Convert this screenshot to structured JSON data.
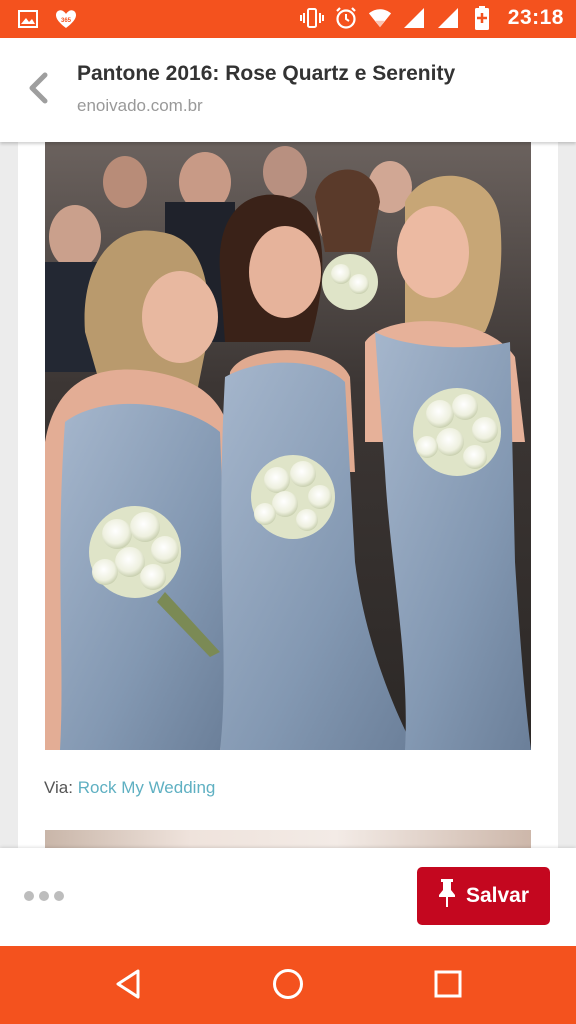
{
  "status_bar": {
    "color": "#f4521e",
    "left_icons": [
      "image-icon",
      "heart-365-icon"
    ],
    "heart_badge": "365",
    "right_icons": [
      "vibrate-icon",
      "alarm-icon",
      "wifi-icon",
      "signal-icon",
      "signal-icon",
      "battery-charging-icon"
    ],
    "time": "23:18"
  },
  "header": {
    "back_icon": "chevron-left-icon",
    "title": "Pantone 2016: Rose Quartz e Serenity",
    "domain": "enoivado.com.br"
  },
  "content": {
    "image_description": "Three bridesmaids in serenity blue dresses holding white rose bouquets",
    "caption_prefix": "Via:",
    "caption_link": "Rock My Wedding",
    "link_color": "#5fb0c2"
  },
  "action_bar": {
    "more_icon": "more-dots-icon",
    "save_icon": "pin-icon",
    "save_label": "Salvar",
    "save_color": "#c4071f"
  },
  "nav_bar": {
    "color": "#f4521e",
    "buttons": [
      "back-triangle-icon",
      "home-circle-icon",
      "recents-square-icon"
    ]
  }
}
